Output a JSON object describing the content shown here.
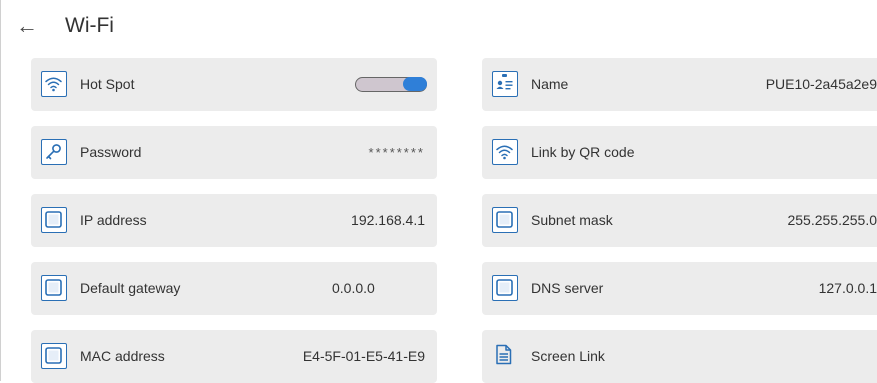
{
  "header": {
    "back_icon": "arrow-left-icon",
    "title": "Wi-Fi"
  },
  "tiles": {
    "hotspot": {
      "label": "Hot Spot",
      "icon": "wifi-icon",
      "enabled": true
    },
    "name": {
      "label": "Name",
      "value": "PUE10-2a45a2e9",
      "icon": "id-card-icon"
    },
    "password": {
      "label": "Password",
      "value": "********",
      "icon": "key-icon"
    },
    "qr": {
      "label": "Link by QR code",
      "icon": "wifi-icon"
    },
    "ip": {
      "label": "IP address",
      "value": "192.168.4.1",
      "icon": "square-icon"
    },
    "subnet": {
      "label": "Subnet mask",
      "value": "255.255.255.0",
      "icon": "square-icon"
    },
    "gateway": {
      "label": "Default gateway",
      "value": "0.0.0.0",
      "icon": "square-icon"
    },
    "dns": {
      "label": "DNS server",
      "value": "127.0.0.1",
      "icon": "square-icon"
    },
    "mac": {
      "label": "MAC address",
      "value": "E4-5F-01-E5-41-E9",
      "icon": "square-icon"
    },
    "screen": {
      "label": "Screen Link",
      "icon": "document-icon"
    }
  },
  "colors": {
    "accent": "#2a6fb5",
    "tile_bg": "#ececec",
    "toggle_on": "#2f7fd8"
  }
}
